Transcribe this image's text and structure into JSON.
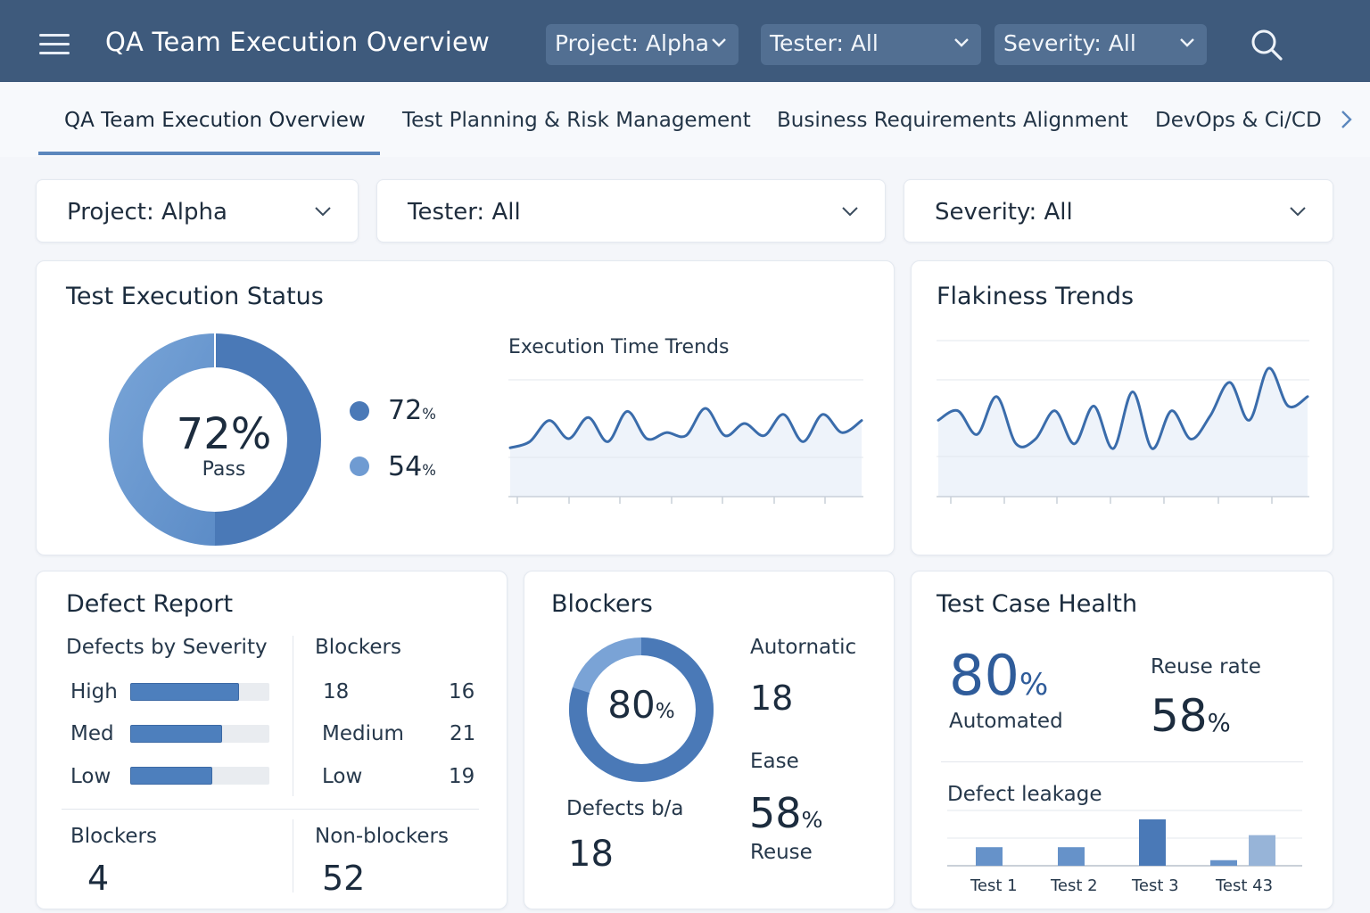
{
  "app": {
    "title": "QA Team Execution Overview"
  },
  "top_filters": [
    {
      "label": "Project: Alpha"
    },
    {
      "label": "Tester: All"
    },
    {
      "label": "Severity: All"
    }
  ],
  "tabs": [
    {
      "label": "QA Team Execution Overview",
      "active": true
    },
    {
      "label": "Test Planning & Risk Management",
      "active": false
    },
    {
      "label": "Business Requirements Alignment",
      "active": false
    },
    {
      "label": "DevOps & Ci/CD",
      "active": false
    }
  ],
  "filters": [
    {
      "label": "Project: Alpha"
    },
    {
      "label": "Tester: All"
    },
    {
      "label": "Severity: All"
    }
  ],
  "execution_status": {
    "title": "Test Execution Status",
    "donut_value": "72%",
    "donut_caption": "Pass",
    "legend": [
      {
        "value": "72",
        "unit": "%"
      },
      {
        "value": "54",
        "unit": "%"
      }
    ],
    "trend_title": "Execution Time Trends"
  },
  "flakiness": {
    "title": "Flakiness Trends"
  },
  "defect_report": {
    "title": "Defect Report",
    "by_severity_title": "Defects by Severity",
    "severity_bars": [
      {
        "label": "High",
        "fraction": 0.78
      },
      {
        "label": "Med",
        "fraction": 0.66
      },
      {
        "label": "Low",
        "fraction": 0.59
      }
    ],
    "blockers_title": "Blockers",
    "blockers_rows": [
      {
        "label": "18",
        "value": "16"
      },
      {
        "label": "Medium",
        "value": "21"
      },
      {
        "label": "Low",
        "value": "19"
      }
    ],
    "blockers_label": "Blockers",
    "blockers_count": "4",
    "non_blockers_label": "Non-blockers",
    "non_blockers_count": "52"
  },
  "blockers_card": {
    "title": "Blockers",
    "donut_value": "80",
    "donut_unit": "%",
    "donut_fraction": 0.8,
    "automatic_label": "Autornatic",
    "automatic_value": "18",
    "ease_label": "Ease",
    "ease_value": "58",
    "ease_unit": "%",
    "reuse_label": "Reuse",
    "defects_label": "Defects b/a",
    "defects_value": "18"
  },
  "test_case_health": {
    "title": "Test Case Health",
    "automated_value": "80",
    "automated_unit": "%",
    "automated_label": "Automated",
    "reuse_label": "Reuse rate",
    "reuse_value": "58",
    "reuse_unit": "%",
    "leakage_title": "Defect leakage",
    "leakage_labels": [
      "Test 1",
      "Test 2",
      "Test 3",
      "Test 43"
    ]
  },
  "chart_data": [
    {
      "type": "pie",
      "values": [
        50,
        50
      ],
      "center_label": "72% Pass"
    },
    {
      "type": "line",
      "title": "Execution Time Trends",
      "series": [
        {
          "values": [
            0.1,
            0.2,
            0.55,
            0.25,
            0.6,
            0.2,
            0.7,
            0.25,
            0.35,
            0.3,
            0.75,
            0.3,
            0.5,
            0.3,
            0.65,
            0.2,
            0.65,
            0.35,
            0.55
          ]
        }
      ]
    },
    {
      "type": "line",
      "title": "Flakiness Trends",
      "series": [
        {
          "values": [
            0.45,
            0.55,
            0.3,
            0.7,
            0.2,
            0.25,
            0.55,
            0.2,
            0.6,
            0.15,
            0.75,
            0.15,
            0.55,
            0.25,
            0.5,
            0.85,
            0.45,
            1.0,
            0.6,
            0.7
          ]
        }
      ]
    },
    {
      "type": "bar",
      "title": "Defect leakage",
      "categories": [
        "Test 1",
        "Test 2",
        "Test 3",
        "Test 43"
      ],
      "series": [
        {
          "values": [
            2,
            2,
            5,
            0.6
          ]
        },
        {
          "values": [
            0,
            0,
            0,
            3.3
          ]
        }
      ]
    }
  ],
  "colors": {
    "header": "#3e5a7c",
    "accent": "#4a79b7",
    "accent_light": "#7aa3d6",
    "bar_light": "#97b4d8"
  }
}
